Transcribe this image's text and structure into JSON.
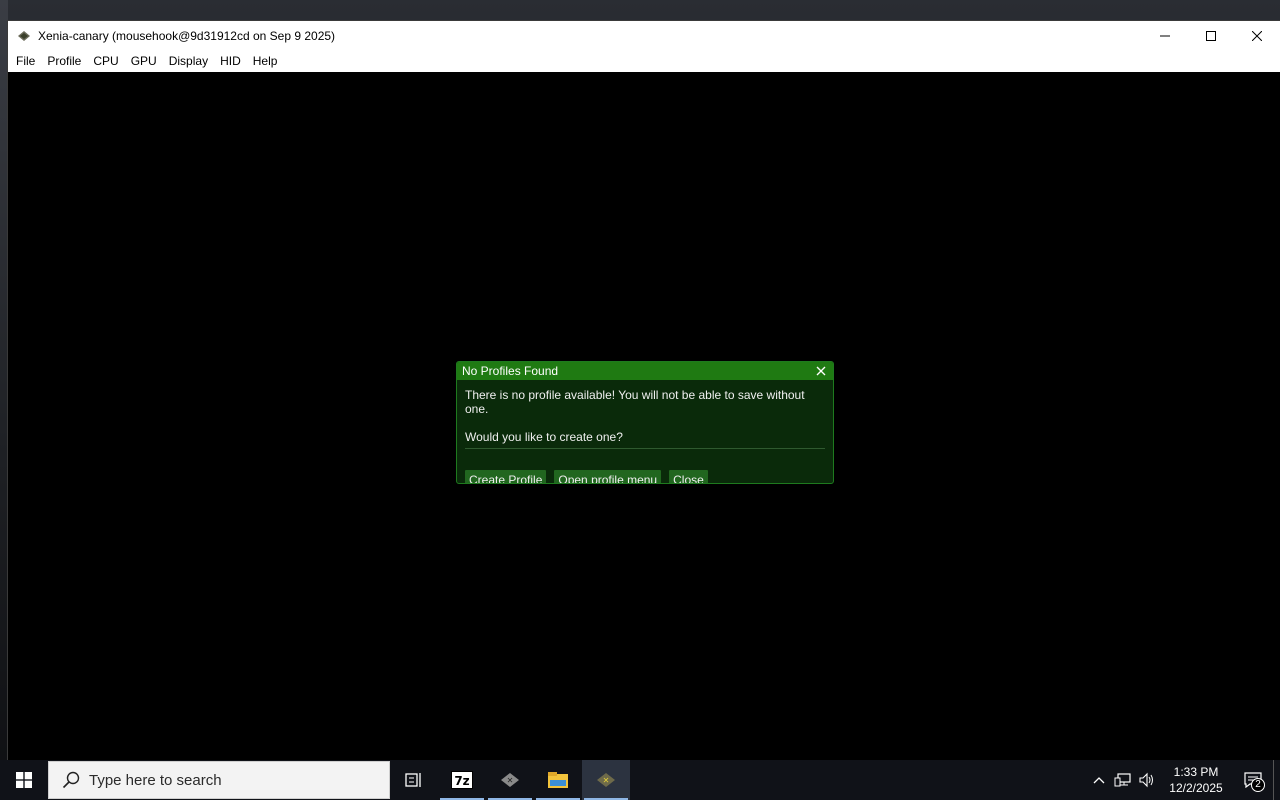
{
  "window": {
    "title": "Xenia-canary (mousehook@9d31912cd on Sep  9 2025)",
    "app_icon": "xenia-diamond-icon",
    "controls": [
      "minimize-icon",
      "maximize-icon",
      "close-icon"
    ]
  },
  "menu": {
    "items": [
      "File",
      "Profile",
      "CPU",
      "GPU",
      "Display",
      "HID",
      "Help"
    ]
  },
  "dialog": {
    "title": "No Profiles Found",
    "message": "There is no profile available! You will not be able to save without one.",
    "question": "Would you like to create one?",
    "buttons": [
      "Create Profile",
      "Open profile menu",
      "Close"
    ],
    "colors": {
      "header": "#1f7a12",
      "body": "#0a2a0a",
      "button": "#21661f"
    }
  },
  "taskbar": {
    "search_placeholder": "Type here to search",
    "apps": [
      "task-view-icon",
      "7zip-icon",
      "xenia-icon",
      "file-explorer-icon",
      "xenia-canary-icon"
    ],
    "time": "1:33 PM",
    "date": "12/2/2025",
    "notification_count": "2"
  }
}
